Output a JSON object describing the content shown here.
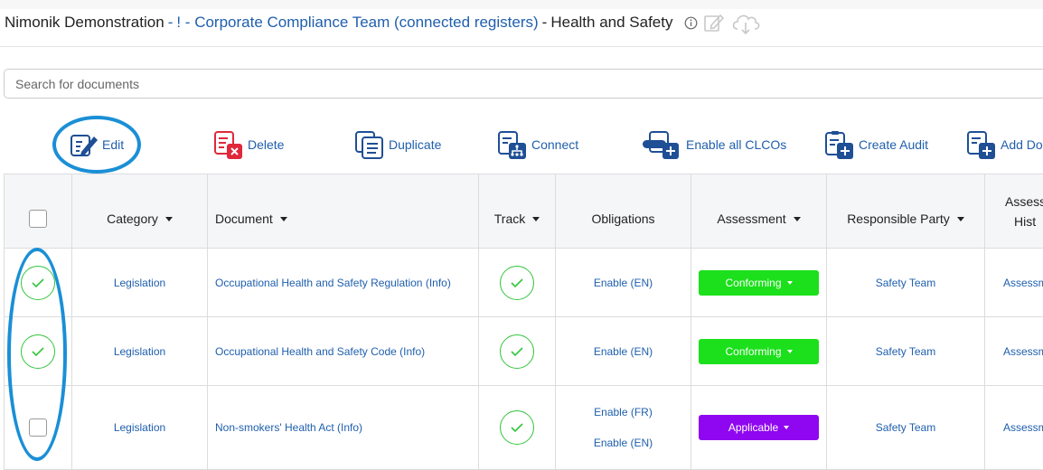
{
  "header": {
    "root": "Nimonik Demonstration",
    "separator": "-",
    "link1": "! - Corporate Compliance Team (connected registers)",
    "current": "Health and Safety"
  },
  "icons": {
    "info": "info-icon",
    "edit": "pencil-square-icon",
    "cloud": "cloud-download-icon"
  },
  "search": {
    "placeholder": "Search for documents",
    "value": ""
  },
  "toolbar": {
    "edit_label": "Edit",
    "delete_label": "Delete",
    "duplicate_label": "Duplicate",
    "connect_label": "Connect",
    "enable_clcos_label": "Enable all CLCOs",
    "create_audit_label": "Create Audit",
    "add_doc_label": "Add Doc"
  },
  "table": {
    "columns": {
      "category": "Category",
      "document": "Document",
      "track": "Track",
      "obligations": "Obligations",
      "assessment": "Assessment",
      "responsible": "Responsible Party",
      "history_1": "Assess",
      "history_2": "Hist"
    },
    "rows": [
      {
        "selected": true,
        "category": "Legislation",
        "document": "Occupational Health and Safety Regulation (Info)",
        "tracked": true,
        "obligations": [
          "Enable (EN)"
        ],
        "assessment": "Conforming",
        "assessment_color": "#1be01b",
        "responsible": "Safety Team",
        "history": "Assessm"
      },
      {
        "selected": true,
        "category": "Legislation",
        "document": "Occupational Health and Safety Code (Info)",
        "tracked": true,
        "obligations": [
          "Enable (EN)"
        ],
        "assessment": "Conforming",
        "assessment_color": "#1be01b",
        "responsible": "Safety Team",
        "history": "Assessm"
      },
      {
        "selected": false,
        "category": "Legislation",
        "document": "Non-smokers' Health Act (Info)",
        "tracked": true,
        "obligations": [
          "Enable (FR)",
          "Enable (EN)"
        ],
        "assessment": "Applicable",
        "assessment_color": "#8f07f0",
        "responsible": "Safety Team",
        "history": "Assessm"
      }
    ]
  },
  "colors": {
    "link": "#1f5fad",
    "annotation": "#1a8fd6",
    "check_green": "#34c53d",
    "delete_red": "#e0283a"
  }
}
